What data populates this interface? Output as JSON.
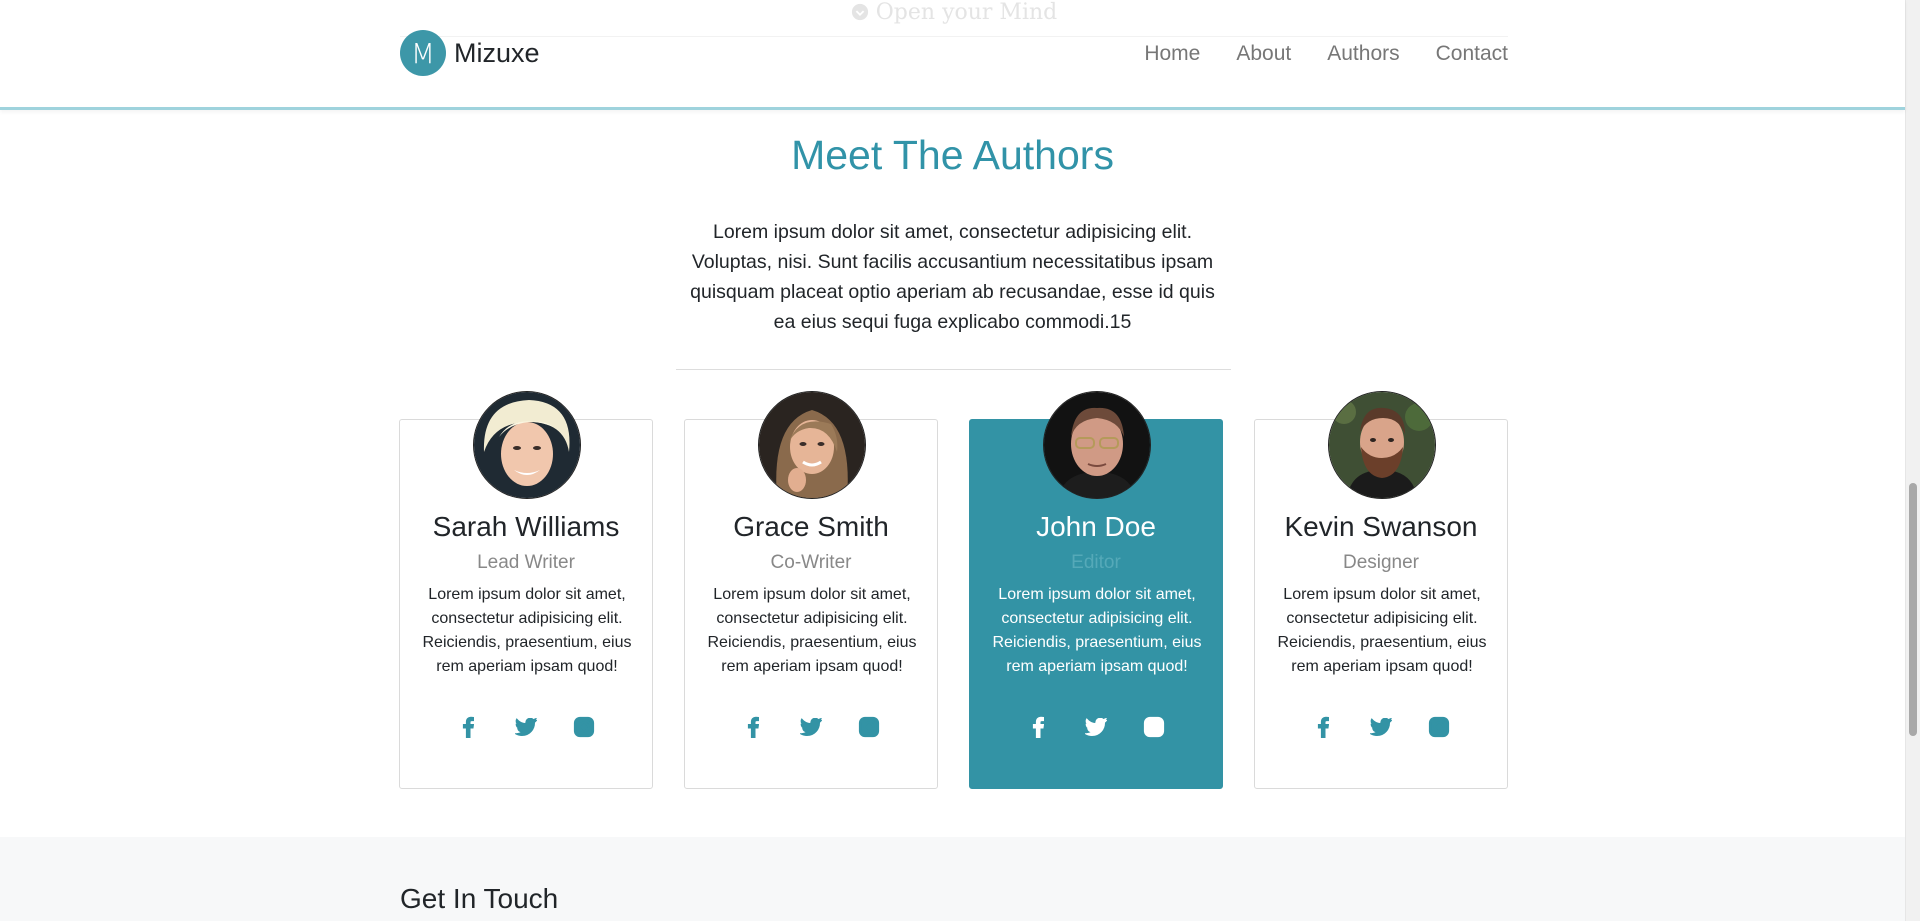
{
  "header": {
    "tagline": "Open your Mind",
    "brand_letter": "M",
    "brand_name": "Mizuxe",
    "nav": [
      "Home",
      "About",
      "Authors",
      "Contact"
    ]
  },
  "authors_section": {
    "title": "Meet The Authors",
    "intro": "Lorem ipsum dolor sit amet, consectetur adipisicing elit. Voluptas, nisi. Sunt facilis accusantium necessitatibus ipsam quisquam placeat optio aperiam ab recusandae, esse id quis ea eius sequi fuga explicabo commodi.15",
    "cards": [
      {
        "name": "Sarah Williams",
        "role": "Lead Writer",
        "text": "Lorem ipsum dolor sit amet, consectetur adipisicing elit. Reiciendis, praesentium, eius rem aperiam ipsam quod!"
      },
      {
        "name": "Grace Smith",
        "role": "Co-Writer",
        "text": "Lorem ipsum dolor sit amet, consectetur adipisicing elit. Reiciendis, praesentium, eius rem aperiam ipsam quod!"
      },
      {
        "name": "John Doe",
        "role": "Editor",
        "text": "Lorem ipsum dolor sit amet, consectetur adipisicing elit. Reiciendis, praesentium, eius rem aperiam ipsam quod!"
      },
      {
        "name": "Kevin Swanson",
        "role": "Designer",
        "text": "Lorem ipsum dolor sit amet, consectetur adipisicing elit. Reiciendis, praesentium, eius rem aperiam ipsam quod!"
      }
    ],
    "social_icons": [
      "facebook-icon",
      "twitter-icon",
      "instagram-icon"
    ]
  },
  "contact": {
    "title": "Get In Touch"
  },
  "colors": {
    "accent": "#3393a5",
    "title": "#3193a8",
    "nav_text": "#777777"
  }
}
